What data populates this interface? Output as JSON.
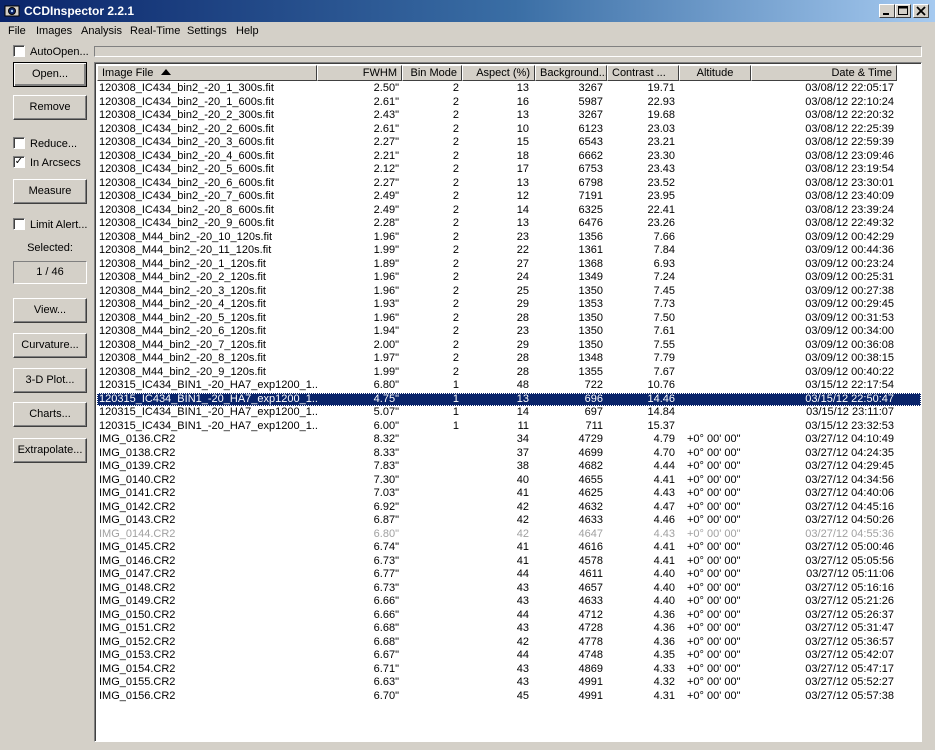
{
  "window": {
    "title": "CCDInspector 2.2.1"
  },
  "menu": [
    "File",
    "Images",
    "Analysis",
    "Real-Time",
    "Settings",
    "Help"
  ],
  "left": {
    "autoopen": {
      "label": "AutoOpen...",
      "checked": false
    },
    "open": "Open...",
    "remove": "Remove",
    "reduce": {
      "label": "Reduce...",
      "checked": false
    },
    "in_arcsecs": {
      "label": "In Arcsecs",
      "checked": true
    },
    "measure": "Measure",
    "limit_alert": {
      "label": "Limit Alert...",
      "checked": false
    },
    "selected_label": "Selected:",
    "selected_value": "1 / 46",
    "view": "View...",
    "curvature": "Curvature...",
    "plot3d": "3-D Plot...",
    "charts": "Charts...",
    "extrapolate": "Extrapolate..."
  },
  "columns": [
    "Image File",
    "FWHM",
    "Bin Mode",
    "Aspect (%)",
    "Background...",
    "Contrast ...",
    "Altitude",
    "Date & Time"
  ],
  "rows": [
    [
      "120308_IC434_bin2_-20_1_300s.fit",
      "2.50\"",
      "2",
      "13",
      "3267",
      "19.71",
      "",
      "03/08/12 22:05:17"
    ],
    [
      "120308_IC434_bin2_-20_1_600s.fit",
      "2.61\"",
      "2",
      "16",
      "5987",
      "22.93",
      "",
      "03/08/12 22:10:24"
    ],
    [
      "120308_IC434_bin2_-20_2_300s.fit",
      "2.43\"",
      "2",
      "13",
      "3267",
      "19.68",
      "",
      "03/08/12 22:20:32"
    ],
    [
      "120308_IC434_bin2_-20_2_600s.fit",
      "2.61\"",
      "2",
      "10",
      "6123",
      "23.03",
      "",
      "03/08/12 22:25:39"
    ],
    [
      "120308_IC434_bin2_-20_3_600s.fit",
      "2.27\"",
      "2",
      "15",
      "6543",
      "23.21",
      "",
      "03/08/12 22:59:39"
    ],
    [
      "120308_IC434_bin2_-20_4_600s.fit",
      "2.21\"",
      "2",
      "18",
      "6662",
      "23.30",
      "",
      "03/08/12 23:09:46"
    ],
    [
      "120308_IC434_bin2_-20_5_600s.fit",
      "2.12\"",
      "2",
      "17",
      "6753",
      "23.43",
      "",
      "03/08/12 23:19:54"
    ],
    [
      "120308_IC434_bin2_-20_6_600s.fit",
      "2.27\"",
      "2",
      "13",
      "6798",
      "23.52",
      "",
      "03/08/12 23:30:01"
    ],
    [
      "120308_IC434_bin2_-20_7_600s.fit",
      "2.49\"",
      "2",
      "12",
      "7191",
      "23.95",
      "",
      "03/08/12 23:40:09"
    ],
    [
      "120308_IC434_bin2_-20_8_600s.fit",
      "2.49\"",
      "2",
      "14",
      "6325",
      "22.41",
      "",
      "03/08/12 23:39:24"
    ],
    [
      "120308_IC434_bin2_-20_9_600s.fit",
      "2.28\"",
      "2",
      "13",
      "6476",
      "23.26",
      "",
      "03/08/12 22:49:32"
    ],
    [
      "120308_M44_bin2_-20_10_120s.fit",
      "1.96\"",
      "2",
      "23",
      "1356",
      "7.66",
      "",
      "03/09/12 00:42:29"
    ],
    [
      "120308_M44_bin2_-20_11_120s.fit",
      "1.99\"",
      "2",
      "22",
      "1361",
      "7.84",
      "",
      "03/09/12 00:44:36"
    ],
    [
      "120308_M44_bin2_-20_1_120s.fit",
      "1.89\"",
      "2",
      "27",
      "1368",
      "6.93",
      "",
      "03/09/12 00:23:24"
    ],
    [
      "120308_M44_bin2_-20_2_120s.fit",
      "1.96\"",
      "2",
      "24",
      "1349",
      "7.24",
      "",
      "03/09/12 00:25:31"
    ],
    [
      "120308_M44_bin2_-20_3_120s.fit",
      "1.96\"",
      "2",
      "25",
      "1350",
      "7.45",
      "",
      "03/09/12 00:27:38"
    ],
    [
      "120308_M44_bin2_-20_4_120s.fit",
      "1.93\"",
      "2",
      "29",
      "1353",
      "7.73",
      "",
      "03/09/12 00:29:45"
    ],
    [
      "120308_M44_bin2_-20_5_120s.fit",
      "1.96\"",
      "2",
      "28",
      "1350",
      "7.50",
      "",
      "03/09/12 00:31:53"
    ],
    [
      "120308_M44_bin2_-20_6_120s.fit",
      "1.94\"",
      "2",
      "23",
      "1350",
      "7.61",
      "",
      "03/09/12 00:34:00"
    ],
    [
      "120308_M44_bin2_-20_7_120s.fit",
      "2.00\"",
      "2",
      "29",
      "1350",
      "7.55",
      "",
      "03/09/12 00:36:08"
    ],
    [
      "120308_M44_bin2_-20_8_120s.fit",
      "1.97\"",
      "2",
      "28",
      "1348",
      "7.79",
      "",
      "03/09/12 00:38:15"
    ],
    [
      "120308_M44_bin2_-20_9_120s.fit",
      "1.99\"",
      "2",
      "28",
      "1355",
      "7.67",
      "",
      "03/09/12 00:40:22"
    ],
    [
      "120315_IC434_BIN1_-20_HA7_exp1200_1...",
      "6.80\"",
      "1",
      "48",
      "722",
      "10.76",
      "",
      "03/15/12 22:17:54"
    ],
    [
      "120315_IC434_BIN1_-20_HA7_exp1200_1...",
      "4.75\"",
      "1",
      "13",
      "696",
      "14.46",
      "",
      "03/15/12 22:50:47"
    ],
    [
      "120315_IC434_BIN1_-20_HA7_exp1200_1...",
      "5.07\"",
      "1",
      "14",
      "697",
      "14.84",
      "",
      "03/15/12 23:11:07"
    ],
    [
      "120315_IC434_BIN1_-20_HA7_exp1200_1...",
      "6.00\"",
      "1",
      "11",
      "711",
      "15.37",
      "",
      "03/15/12 23:32:53"
    ],
    [
      "IMG_0136.CR2",
      "8.32\"",
      "",
      "34",
      "4729",
      "4.79",
      "+0° 00' 00\"",
      "03/27/12 04:10:49"
    ],
    [
      "IMG_0138.CR2",
      "8.33\"",
      "",
      "37",
      "4699",
      "4.70",
      "+0° 00' 00\"",
      "03/27/12 04:24:35"
    ],
    [
      "IMG_0139.CR2",
      "7.83\"",
      "",
      "38",
      "4682",
      "4.44",
      "+0° 00' 00\"",
      "03/27/12 04:29:45"
    ],
    [
      "IMG_0140.CR2",
      "7.30\"",
      "",
      "40",
      "4655",
      "4.41",
      "+0° 00' 00\"",
      "03/27/12 04:34:56"
    ],
    [
      "IMG_0141.CR2",
      "7.03\"",
      "",
      "41",
      "4625",
      "4.43",
      "+0° 00' 00\"",
      "03/27/12 04:40:06"
    ],
    [
      "IMG_0142.CR2",
      "6.92\"",
      "",
      "42",
      "4632",
      "4.47",
      "+0° 00' 00\"",
      "03/27/12 04:45:16"
    ],
    [
      "IMG_0143.CR2",
      "6.87\"",
      "",
      "42",
      "4633",
      "4.46",
      "+0° 00' 00\"",
      "03/27/12 04:50:26"
    ],
    [
      "IMG_0144.CR2",
      "6.80\"",
      "",
      "42",
      "4647",
      "4.43",
      "+0° 00' 00\"",
      "03/27/12 04:55:36"
    ],
    [
      "IMG_0145.CR2",
      "6.74\"",
      "",
      "41",
      "4616",
      "4.41",
      "+0° 00' 00\"",
      "03/27/12 05:00:46"
    ],
    [
      "IMG_0146.CR2",
      "6.73\"",
      "",
      "41",
      "4578",
      "4.41",
      "+0° 00' 00\"",
      "03/27/12 05:05:56"
    ],
    [
      "IMG_0147.CR2",
      "6.77\"",
      "",
      "44",
      "4611",
      "4.40",
      "+0° 00' 00\"",
      "03/27/12 05:11:06"
    ],
    [
      "IMG_0148.CR2",
      "6.73\"",
      "",
      "43",
      "4657",
      "4.40",
      "+0° 00' 00\"",
      "03/27/12 05:16:16"
    ],
    [
      "IMG_0149.CR2",
      "6.66\"",
      "",
      "43",
      "4633",
      "4.40",
      "+0° 00' 00\"",
      "03/27/12 05:21:26"
    ],
    [
      "IMG_0150.CR2",
      "6.66\"",
      "",
      "44",
      "4712",
      "4.36",
      "+0° 00' 00\"",
      "03/27/12 05:26:37"
    ],
    [
      "IMG_0151.CR2",
      "6.68\"",
      "",
      "43",
      "4728",
      "4.36",
      "+0° 00' 00\"",
      "03/27/12 05:31:47"
    ],
    [
      "IMG_0152.CR2",
      "6.68\"",
      "",
      "42",
      "4778",
      "4.36",
      "+0° 00' 00\"",
      "03/27/12 05:36:57"
    ],
    [
      "IMG_0153.CR2",
      "6.67\"",
      "",
      "44",
      "4748",
      "4.35",
      "+0° 00' 00\"",
      "03/27/12 05:42:07"
    ],
    [
      "IMG_0154.CR2",
      "6.71\"",
      "",
      "43",
      "4869",
      "4.33",
      "+0° 00' 00\"",
      "03/27/12 05:47:17"
    ],
    [
      "IMG_0155.CR2",
      "6.63\"",
      "",
      "43",
      "4991",
      "4.32",
      "+0° 00' 00\"",
      "03/27/12 05:52:27"
    ],
    [
      "IMG_0156.CR2",
      "6.70\"",
      "",
      "45",
      "4991",
      "4.31",
      "+0° 00' 00\"",
      "03/27/12 05:57:38"
    ]
  ],
  "selected_row": 23,
  "dimmed_rows": [
    33
  ]
}
